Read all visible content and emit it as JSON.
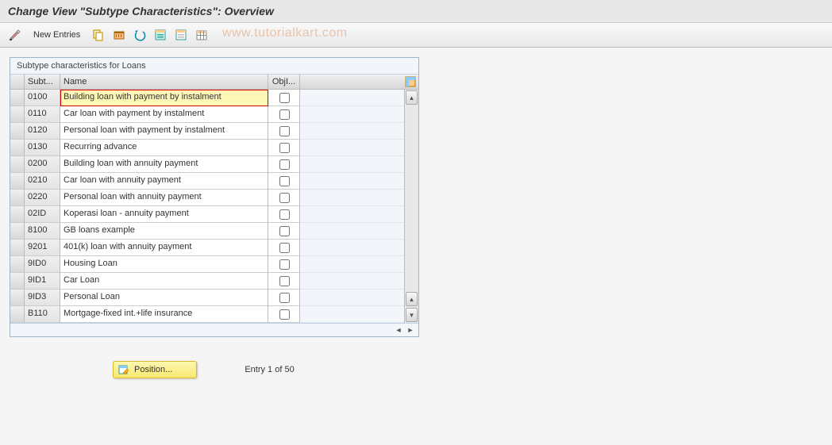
{
  "header": {
    "title": "Change View \"Subtype Characteristics\": Overview"
  },
  "toolbar": {
    "new_entries_label": "New Entries"
  },
  "watermark": "www.tutorialkart.com",
  "panel": {
    "title": "Subtype characteristics for Loans"
  },
  "columns": {
    "subt": "Subt...",
    "name": "Name",
    "obj": "ObjI..."
  },
  "rows": [
    {
      "subt": "0100",
      "name": "Building loan with payment by instalment",
      "selected": true
    },
    {
      "subt": "0110",
      "name": "Car loan with payment by instalment"
    },
    {
      "subt": "0120",
      "name": "Personal loan with payment by instalment"
    },
    {
      "subt": "0130",
      "name": "Recurring advance"
    },
    {
      "subt": "0200",
      "name": "Building loan with annuity payment"
    },
    {
      "subt": "0210",
      "name": "Car loan with annuity payment"
    },
    {
      "subt": "0220",
      "name": "Personal loan with annuity payment"
    },
    {
      "subt": "02ID",
      "name": "Koperasi loan - annuity payment"
    },
    {
      "subt": "8100",
      "name": "GB loans example"
    },
    {
      "subt": "9201",
      "name": "401(k) loan with annuity payment"
    },
    {
      "subt": "9ID0",
      "name": "Housing Loan"
    },
    {
      "subt": "9ID1",
      "name": "Car Loan"
    },
    {
      "subt": "9ID3",
      "name": "Personal Loan"
    },
    {
      "subt": "B110",
      "name": "Mortgage-fixed int.+life insurance"
    }
  ],
  "footer": {
    "position_label": "Position...",
    "entry_text": "Entry 1 of 50"
  }
}
